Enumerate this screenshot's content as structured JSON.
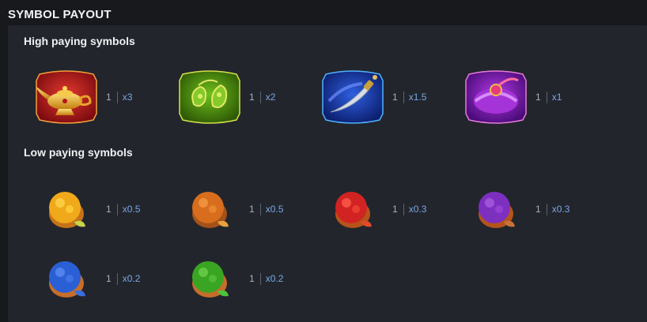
{
  "title": "SYMBOL PAYOUT",
  "high": {
    "heading": "High paying symbols",
    "symbols": [
      {
        "icon": "magic-lamp-icon",
        "count": "1",
        "mult": "x3",
        "color": "#c6161d"
      },
      {
        "icon": "jewel-pendant-icon",
        "count": "1",
        "mult": "x2",
        "color": "#5fa312"
      },
      {
        "icon": "dagger-icon",
        "count": "1",
        "mult": "x1.5",
        "color": "#1d4fc4"
      },
      {
        "icon": "turban-icon",
        "count": "1",
        "mult": "x1",
        "color": "#8a1fc1"
      }
    ]
  },
  "low": {
    "heading": "Low paying symbols",
    "symbols": [
      {
        "icon": "yellow-spice-bowl-icon",
        "count": "1",
        "mult": "x0.5",
        "color": "#f0a91a"
      },
      {
        "icon": "orange-spice-bowl-icon",
        "count": "1",
        "mult": "x0.5",
        "color": "#d86d1d"
      },
      {
        "icon": "red-spice-bowl-icon",
        "count": "1",
        "mult": "x0.3",
        "color": "#d22323"
      },
      {
        "icon": "purple-spice-bowl-icon",
        "count": "1",
        "mult": "x0.3",
        "color": "#7d2fbf"
      },
      {
        "icon": "blue-spice-bowl-icon",
        "count": "1",
        "mult": "x0.2",
        "color": "#2a5fd6"
      },
      {
        "icon": "green-spice-bowl-icon",
        "count": "1",
        "mult": "x0.2",
        "color": "#3aa523"
      }
    ]
  }
}
